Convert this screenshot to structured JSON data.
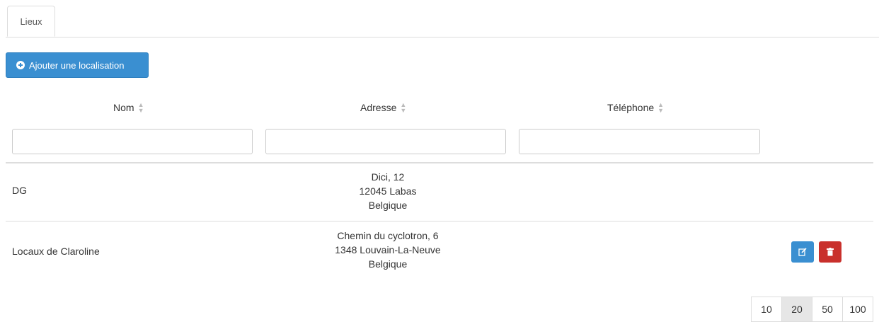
{
  "tabs": [
    {
      "label": "Lieux"
    }
  ],
  "toolbar": {
    "add_label": "Ajouter une localisation"
  },
  "table": {
    "columns": [
      "Nom",
      "Adresse",
      "Téléphone"
    ],
    "filters": {
      "nom": "",
      "adresse": "",
      "telephone": ""
    },
    "rows": [
      {
        "name": "DG",
        "address": [
          "Dici, 12",
          "12045 Labas",
          "Belgique"
        ],
        "phone": ""
      },
      {
        "name": "Locaux de Claroline",
        "address": [
          "Chemin du cyclotron, 6",
          "1348 Louvain-La-Neuve",
          "Belgique"
        ],
        "phone": ""
      }
    ]
  },
  "pagination": {
    "sizes": [
      "10",
      "20",
      "50",
      "100"
    ],
    "active": "20"
  },
  "colors": {
    "primary": "#3a8fd1",
    "danger": "#c9302c"
  }
}
